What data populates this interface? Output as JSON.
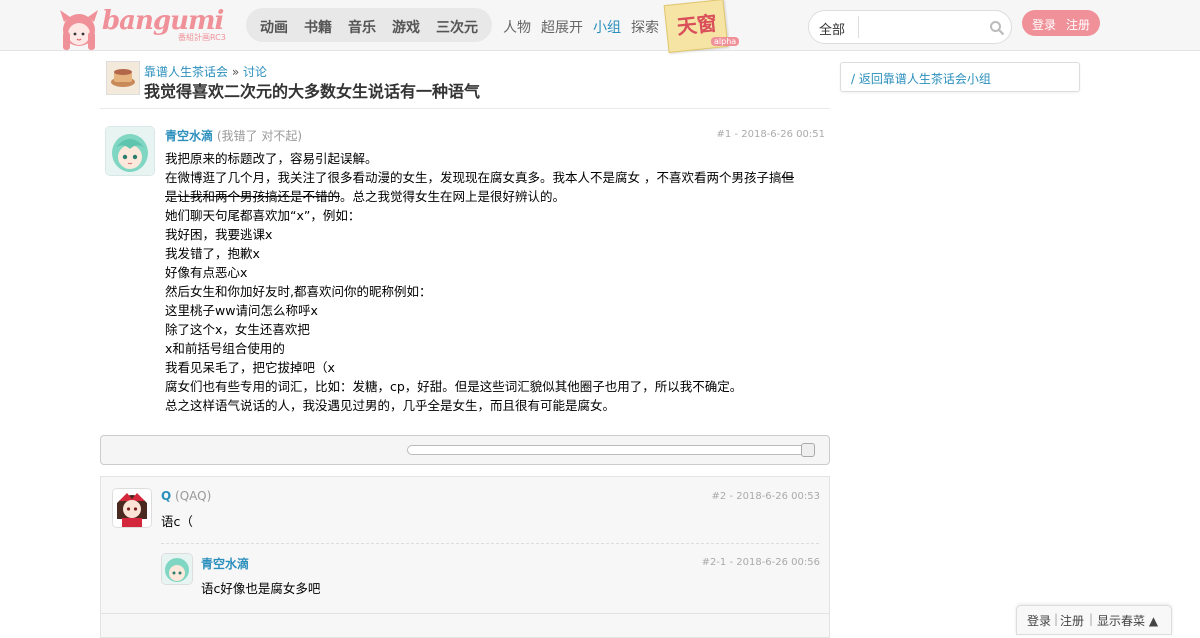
{
  "header": {
    "logo_text": "bangumi",
    "logo_sub": "番組計画RC3",
    "main_nav": [
      "动画",
      "书籍",
      "音乐",
      "游戏",
      "三次元"
    ],
    "sub_nav": [
      "人物",
      "超展开",
      "小组",
      "探索"
    ],
    "active_sub": "小组",
    "tianchuang": "天窗",
    "tianchuang_badge": "alpha",
    "search_scope": "全部",
    "search_placeholder": "",
    "login": "登录",
    "register": "注册"
  },
  "topic": {
    "group": "靠谱人生茶话会",
    "breadcrumb_sep": " » ",
    "section": "讨论",
    "title": "我觉得喜欢二次元的大多数女生说话有一种语气"
  },
  "op": {
    "user": "青空水滴",
    "sign": "(我错了 对不起)",
    "floor": "#1 - 2018-6-26 00:51",
    "lines": [
      "我把原来的标题改了，容易引起误解。",
      "在微博逛了几个月，我关注了很多看动漫的女生，发现现在腐女真多。我本人不是腐女 ，不喜欢看两个男孩子搞",
      "。总之我觉得女生在网上是很好辨认的。",
      "她们聊天句尾都喜欢加“x”，例如：",
      "我好困，我要逃课x",
      "我发错了，抱歉x",
      "好像有点恶心x",
      "然后女生和你加好友时,都喜欢问你的昵称例如：",
      "这里桃子ww请问怎么称呼x",
      "除了这个x，女生还喜欢把",
      "x和前括号组合使用的",
      "我看见呆毛了，把它拔掉吧（x",
      "腐女们也有些专用的词汇，比如：发糖，cp，好甜。但是这些词汇貌似其他圈子也用了，所以我不确定。",
      "总之这样语气说话的人，我没遇见过男的，几乎全是女生，而且很有可能是腐女。"
    ],
    "strike_a": "但",
    "strike_b": "是让我和两个男孩搞还是不错的"
  },
  "replies": [
    {
      "user": "Q",
      "sign": "(QAQ)",
      "floor": "#2 - 2018-6-26 00:53",
      "text": "语c（",
      "sub": {
        "user": "青空水滴",
        "floor": "#2-1 - 2018-6-26 00:56",
        "text": "语c好像也是腐女多吧"
      }
    }
  ],
  "sidebar": {
    "back_link": "/ 返回靠谱人生茶话会小组"
  },
  "dock": {
    "login": "登录",
    "register": "注册",
    "toggle": "显示春菜 ▲"
  },
  "colors": {
    "brand_pink": "#f09199",
    "link_blue": "#2b8fbd"
  }
}
